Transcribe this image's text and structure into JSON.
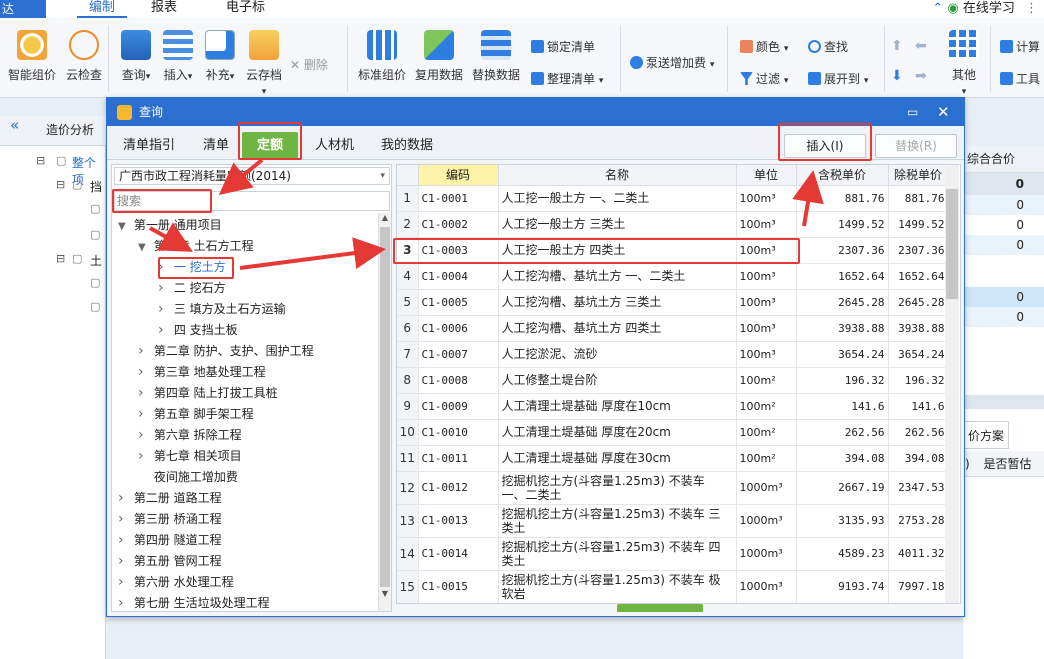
{
  "app": {
    "title_stub": "达"
  },
  "top_tabs": [
    "编制",
    "报表",
    "电子标"
  ],
  "top_right": {
    "help_label": "在线学习"
  },
  "ribbon": {
    "big_left": [
      "智能组价",
      "云检查"
    ],
    "big_mid": [
      "查询",
      "插入",
      "补充",
      "云存档"
    ],
    "delete_label": "删除",
    "big_tools": [
      "标准组价",
      "复用数据",
      "替换数据"
    ],
    "lock_label": "锁定清单",
    "organize_label": "整理清单",
    "pump_label": "泵送增加费",
    "color_label": "颜色",
    "find_label": "查找",
    "filter_label": "过滤",
    "expand_label": "展开到",
    "other_label": "其他",
    "calc_label": "计算",
    "tools_label": "工具"
  },
  "left_panel": {
    "tab_label": "造价分析",
    "root_label": "整个项",
    "items": [
      "挡",
      "土"
    ]
  },
  "right_panel": {
    "col_header": "综合合价",
    "values": [
      "0",
      "0",
      "0",
      "0",
      "0",
      "0"
    ],
    "plan_label": "价方案",
    "temp_label": "是否暂估",
    "paren": ")"
  },
  "dialog": {
    "title": "查询",
    "tabs": [
      "清单指引",
      "清单",
      "定额",
      "人材机",
      "我的数据"
    ],
    "active_tab": "定额",
    "insert_label": "插入(I)",
    "replace_label": "替换(R)",
    "library": "广西市政工程消耗量定额(2014)",
    "search_placeholder": "搜索",
    "tree": [
      {
        "level": 0,
        "label": "第一册  通用项目",
        "arrow": "down"
      },
      {
        "level": 1,
        "label": "第一章  土石方工程",
        "arrow": "down"
      },
      {
        "level": 2,
        "label": "一  挖土方",
        "arrow": "right",
        "selected": true
      },
      {
        "level": 2,
        "label": "二  挖石方",
        "arrow": "right"
      },
      {
        "level": 2,
        "label": "三  填方及土石方运输",
        "arrow": "right"
      },
      {
        "level": 2,
        "label": "四  支挡土板",
        "arrow": "right"
      },
      {
        "level": 1,
        "label": "第二章  防护、支护、围护工程",
        "arrow": "right"
      },
      {
        "level": 1,
        "label": "第三章  地基处理工程",
        "arrow": "right"
      },
      {
        "level": 1,
        "label": "第四章  陆上打拔工具桩",
        "arrow": "right"
      },
      {
        "level": 1,
        "label": "第五章  脚手架工程",
        "arrow": "right"
      },
      {
        "level": 1,
        "label": "第六章  拆除工程",
        "arrow": "right"
      },
      {
        "level": 1,
        "label": "第七章  相关项目",
        "arrow": "right"
      },
      {
        "level": 1,
        "label": "夜间施工增加费",
        "arrow": ""
      },
      {
        "level": 0,
        "label": "第二册  道路工程",
        "arrow": "right"
      },
      {
        "level": 0,
        "label": "第三册  桥涵工程",
        "arrow": "right"
      },
      {
        "level": 0,
        "label": "第四册  隧道工程",
        "arrow": "right"
      },
      {
        "level": 0,
        "label": "第五册  管网工程",
        "arrow": "right"
      },
      {
        "level": 0,
        "label": "第六册  水处理工程",
        "arrow": "right"
      },
      {
        "level": 0,
        "label": "第七册  生活垃圾处理工程",
        "arrow": "right"
      }
    ],
    "columns": [
      "编码",
      "名称",
      "单位",
      "含税单价",
      "除税单价"
    ],
    "rows": [
      {
        "n": "1",
        "code": "C1-0001",
        "name": "人工挖一般土方  一、二类土",
        "unit": "100m³",
        "tax": "881.76",
        "notax": "881.76",
        "h": 26
      },
      {
        "n": "2",
        "code": "C1-0002",
        "name": "人工挖一般土方  三类土",
        "unit": "100m³",
        "tax": "1499.52",
        "notax": "1499.52",
        "h": 26
      },
      {
        "n": "3",
        "code": "C1-0003",
        "name": "人工挖一般土方  四类土",
        "unit": "100m³",
        "tax": "2307.36",
        "notax": "2307.36",
        "h": 26,
        "selected": true
      },
      {
        "n": "4",
        "code": "C1-0004",
        "name": "人工挖沟槽、基坑土方  一、二类土",
        "unit": "100m³",
        "tax": "1652.64",
        "notax": "1652.64",
        "h": 26
      },
      {
        "n": "5",
        "code": "C1-0005",
        "name": "人工挖沟槽、基坑土方  三类土",
        "unit": "100m³",
        "tax": "2645.28",
        "notax": "2645.28",
        "h": 26
      },
      {
        "n": "6",
        "code": "C1-0006",
        "name": "人工挖沟槽、基坑土方  四类土",
        "unit": "100m³",
        "tax": "3938.88",
        "notax": "3938.88",
        "h": 26
      },
      {
        "n": "7",
        "code": "C1-0007",
        "name": "人工挖淤泥、流砂",
        "unit": "100m³",
        "tax": "3654.24",
        "notax": "3654.24",
        "h": 26
      },
      {
        "n": "8",
        "code": "C1-0008",
        "name": "人工修整土堤台阶",
        "unit": "100m²",
        "tax": "196.32",
        "notax": "196.32",
        "h": 26
      },
      {
        "n": "9",
        "code": "C1-0009",
        "name": "人工清理土堤基础  厚度在10cm",
        "unit": "100m²",
        "tax": "141.6",
        "notax": "141.6",
        "h": 26
      },
      {
        "n": "10",
        "code": "C1-0010",
        "name": "人工清理土堤基础  厚度在20cm",
        "unit": "100m²",
        "tax": "262.56",
        "notax": "262.56",
        "h": 26
      },
      {
        "n": "11",
        "code": "C1-0011",
        "name": "人工清理土堤基础  厚度在30cm",
        "unit": "100m²",
        "tax": "394.08",
        "notax": "394.08",
        "h": 26
      },
      {
        "n": "12",
        "code": "C1-0012",
        "name": "挖掘机挖土方(斗容量1.25m3)  不装车  一、二类土",
        "unit": "1000m³",
        "tax": "2667.19",
        "notax": "2347.53",
        "h": 33
      },
      {
        "n": "13",
        "code": "C1-0013",
        "name": "挖掘机挖土方(斗容量1.25m3)  不装车  三类土",
        "unit": "1000m³",
        "tax": "3135.93",
        "notax": "2753.28",
        "h": 33
      },
      {
        "n": "14",
        "code": "C1-0014",
        "name": "挖掘机挖土方(斗容量1.25m3)  不装车  四类土",
        "unit": "1000m³",
        "tax": "4589.23",
        "notax": "4011.32",
        "h": 33
      },
      {
        "n": "15",
        "code": "C1-0015",
        "name": "挖掘机挖土方(斗容量1.25m3)  不装车  极软岩",
        "unit": "1000m³",
        "tax": "9193.74",
        "notax": "7997.18",
        "h": 33
      }
    ]
  },
  "colors": {
    "accent": "#2b6fd1",
    "active_tab": "#6fb543",
    "highlight_red": "#e53935"
  }
}
